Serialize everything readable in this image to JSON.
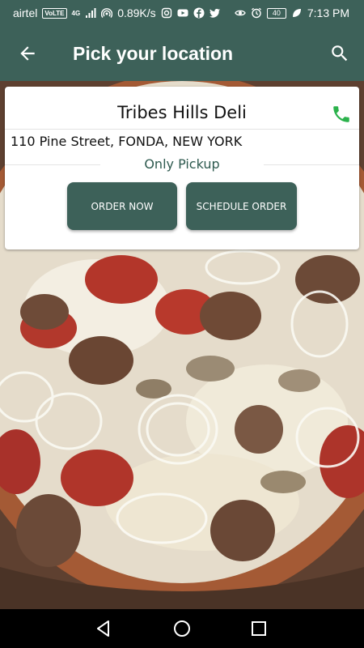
{
  "status_bar": {
    "carrier": "airtel",
    "volte": "VoLTE",
    "network": "4G",
    "speed": "0.89K/s",
    "battery": "40",
    "time": "7:13 PM"
  },
  "app_bar": {
    "title": "Pick your location",
    "back_icon": "arrow-left-icon",
    "search_icon": "search-icon"
  },
  "card": {
    "store_name": "Tribes Hills Deli",
    "address": "110 Pine Street, FONDA, NEW YORK",
    "pickup_label": "Only Pickup",
    "phone_icon": "phone-icon",
    "buttons": {
      "order_now": "ORDER NOW",
      "schedule_order": "SCHEDULE ORDER"
    }
  },
  "nav_bar": {
    "back_icon": "triangle-back-icon",
    "home_icon": "circle-home-icon",
    "recent_icon": "square-recent-icon"
  },
  "colors": {
    "primary": "#3d6159",
    "phone_green": "#2bb24c",
    "pickup_text": "#2e5a4f"
  }
}
